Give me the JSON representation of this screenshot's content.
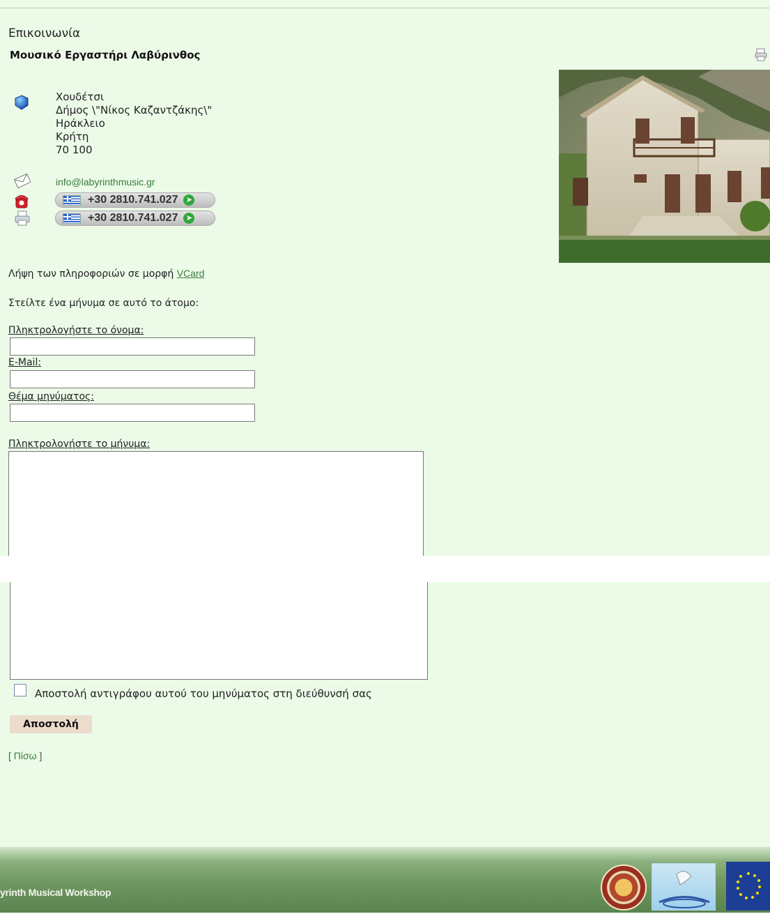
{
  "page": {
    "heading": "Επικοινωνία",
    "contact_name": "Μουσικό Εργαστήρι Λαβύρινθος"
  },
  "address": {
    "lines": [
      "Χουδέτσι",
      "Δήμος \\\"Νίκος Καζαντζάκης\\\"",
      "Ηράκλειο",
      "Κρήτη",
      "70 100"
    ]
  },
  "contact": {
    "email": "info@labyrinthmusic.gr",
    "phone": "+30 2810.741.027",
    "fax": "+30 2810.741.027"
  },
  "vcard": {
    "prefix": "Λήψη των πληροφοριών σε μορφή ",
    "link": "VCard"
  },
  "form": {
    "intro": "Στείλτε ένα μήνυμα σε αυτό το άτομο:",
    "name_label": "Πληκτρολογήστε το όνομα:",
    "name_value": "",
    "email_label": "E-Mail:",
    "email_value": "",
    "subject_label": "Θέμα μηνύματος:",
    "subject_value": "",
    "message_label": "Πληκτρολογήστε το μήνυμα:",
    "message_value": "",
    "copy_label": "Αποστολή αντιγράφου αυτού του μηνύματος στη διεύθυνσή σας",
    "copy_checked": false,
    "submit_label": "Αποστολή",
    "back_open": "[ ",
    "back_label": "Πίσω",
    "back_close": " ]"
  },
  "footer": {
    "text": "yrinth Musical Workshop"
  },
  "icons": {
    "address": "globe-icon",
    "email": "envelope-icon",
    "phone": "telephone-icon",
    "fax": "fax-icon",
    "print": "print-icon"
  },
  "colors": {
    "background": "#ebfbe8",
    "link": "#3b7a3b",
    "footer": "#6f9762",
    "submit_bg": "#ecdccc"
  }
}
